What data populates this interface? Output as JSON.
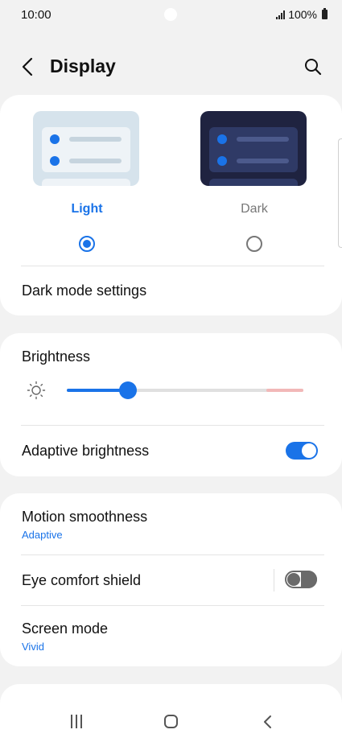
{
  "status_bar": {
    "time": "10:00",
    "battery": "100%"
  },
  "header": {
    "title": "Display"
  },
  "theme": {
    "options": [
      {
        "label": "Light",
        "selected": true
      },
      {
        "label": "Dark",
        "selected": false
      }
    ],
    "dark_mode_settings_label": "Dark mode settings"
  },
  "brightness": {
    "label": "Brightness",
    "level": 0.26,
    "adaptive_label": "Adaptive brightness",
    "adaptive_on": true
  },
  "motion": {
    "label": "Motion smoothness",
    "value": "Adaptive"
  },
  "eye_comfort": {
    "label": "Eye comfort shield",
    "on": false
  },
  "screen_mode": {
    "label": "Screen mode",
    "value": "Vivid"
  },
  "colors": {
    "accent": "#1a73e8",
    "background": "#f2f2f2",
    "card": "#ffffff"
  }
}
